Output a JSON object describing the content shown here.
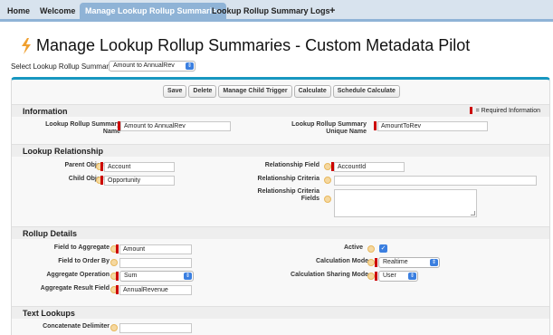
{
  "tabs": [
    {
      "label": "Home"
    },
    {
      "label": "Welcome"
    },
    {
      "label": "Manage Lookup Rollup Summaries"
    },
    {
      "label": "Lookup Rollup Summary Logs"
    },
    {
      "label": "+"
    }
  ],
  "page": {
    "title": "Manage Lookup Rollup Summaries - Custom Metadata Pilot",
    "select_label": "Select Lookup Rollup Summary:",
    "select_value": "Amount to AnnualRev"
  },
  "buttons": [
    "Save",
    "Delete",
    "Manage Child Trigger",
    "Calculate",
    "Schedule Calculate"
  ],
  "information": {
    "heading": "Information",
    "required_note": "= Required Information",
    "name_label_1": "Lookup Rollup Summary",
    "name_label_2": "Name",
    "name_value": "Amount to AnnualRev",
    "unique_label_1": "Lookup Rollup Summary",
    "unique_label_2": "Unique Name",
    "unique_value": "AmountToRev"
  },
  "relationship": {
    "heading": "Lookup Relationship",
    "parent_label": "Parent Object",
    "parent_value": "Account",
    "child_label": "Child Object",
    "child_value": "Opportunity",
    "rel_field_label": "Relationship Field",
    "rel_field_value": "AccountId",
    "rel_criteria_label": "Relationship Criteria",
    "rel_criteria_value": "",
    "rel_fields_label_1": "Relationship Criteria",
    "rel_fields_label_2": "Fields",
    "rel_fields_value": ""
  },
  "rollup": {
    "heading": "Rollup Details",
    "aggregate_label": "Field to Aggregate",
    "aggregate_value": "Amount",
    "order_label": "Field to Order By",
    "order_value": "",
    "operation_label": "Aggregate Operation",
    "operation_value": "Sum",
    "result_label": "Aggregate Result Field",
    "result_value": "AnnualRevenue",
    "active_label": "Active",
    "active_checked": true,
    "calc_mode_label": "Calculation Mode",
    "calc_mode_value": "Realtime",
    "sharing_label": "Calculation Sharing Mode",
    "sharing_value": "User"
  },
  "text_lookups": {
    "heading": "Text Lookups",
    "delimiter_label": "Concatenate Delimiter",
    "delimiter_value": ""
  },
  "colors": {
    "tab_bar": "#d8e3ee",
    "tab_active": "#8fb3d6",
    "panel_accent": "#1797c0",
    "required": "#cc0000",
    "select_arrow": "#3b7fe0"
  }
}
